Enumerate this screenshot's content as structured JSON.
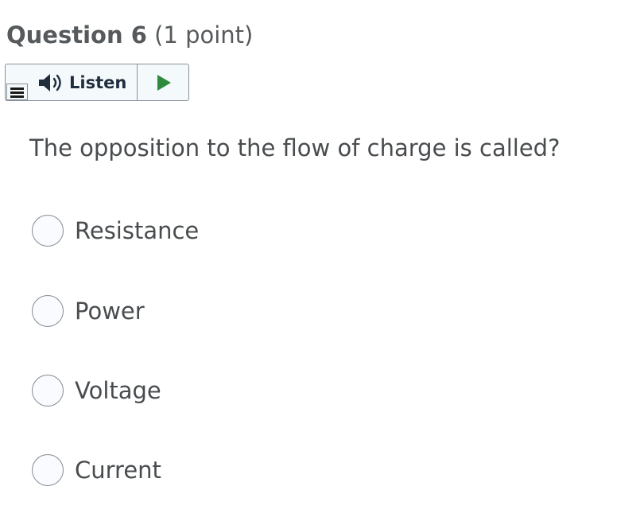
{
  "question": {
    "title": "Question 6",
    "points": "(1 point)",
    "text": "The opposition to the flow of charge is called?"
  },
  "listen_toolbar": {
    "listen_label": "Listen",
    "menu_icon": "menu-lines-icon",
    "speaker_icon": "speaker-icon",
    "play_icon": "play-icon",
    "play_color": "#2e8b3d"
  },
  "options": [
    {
      "label": "Resistance"
    },
    {
      "label": "Power"
    },
    {
      "label": "Voltage"
    },
    {
      "label": "Current"
    }
  ]
}
